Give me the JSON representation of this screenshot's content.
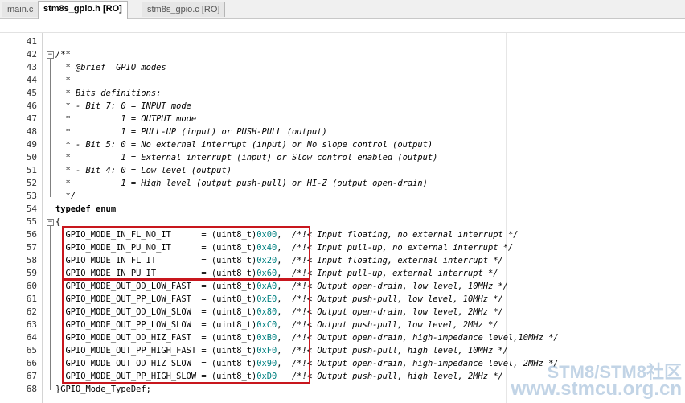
{
  "tabs": [
    {
      "label": "main.c",
      "active": false
    },
    {
      "label": "stm8s_gpio.h [RO]",
      "active": true
    },
    {
      "label": "stm8s_gpio.c [RO]",
      "active": false
    }
  ],
  "lines": [
    {
      "n": "41",
      "parts": []
    },
    {
      "n": "42",
      "parts": [
        {
          "t": "/**",
          "c": "cm"
        }
      ]
    },
    {
      "n": "43",
      "parts": [
        {
          "t": "  * @brief  GPIO modes",
          "c": "cm"
        }
      ]
    },
    {
      "n": "44",
      "parts": [
        {
          "t": "  *",
          "c": "cm"
        }
      ]
    },
    {
      "n": "45",
      "parts": [
        {
          "t": "  * Bits definitions:",
          "c": "cm"
        }
      ]
    },
    {
      "n": "46",
      "parts": [
        {
          "t": "  * - Bit 7: 0 = INPUT mode",
          "c": "cm"
        }
      ]
    },
    {
      "n": "47",
      "parts": [
        {
          "t": "  *          1 = OUTPUT mode",
          "c": "cm"
        }
      ]
    },
    {
      "n": "48",
      "parts": [
        {
          "t": "  *          1 = PULL-UP (input) or PUSH-PULL (output)",
          "c": "cm"
        }
      ]
    },
    {
      "n": "49",
      "parts": [
        {
          "t": "  * - Bit 5: 0 = No external interrupt (input) or No slope control (output)",
          "c": "cm"
        }
      ]
    },
    {
      "n": "50",
      "parts": [
        {
          "t": "  *          1 = External interrupt (input) or Slow control enabled (output)",
          "c": "cm"
        }
      ]
    },
    {
      "n": "51",
      "parts": [
        {
          "t": "  * - Bit 4: 0 = Low level (output)",
          "c": "cm"
        }
      ]
    },
    {
      "n": "52",
      "parts": [
        {
          "t": "  *          1 = High level (output push-pull) or HI-Z (output open-drain)",
          "c": "cm"
        }
      ]
    },
    {
      "n": "53",
      "parts": [
        {
          "t": "  */",
          "c": "cm"
        }
      ]
    },
    {
      "n": "54",
      "parts": [
        {
          "t": "typedef enum",
          "c": "kw"
        }
      ]
    },
    {
      "n": "55",
      "parts": [
        {
          "t": "{",
          "c": ""
        }
      ]
    },
    {
      "n": "56",
      "parts": [
        {
          "t": "  GPIO_MODE_IN_FL_NO_IT      = (uint8_t)",
          "c": ""
        },
        {
          "t": "0x00",
          "c": "hex"
        },
        {
          "t": ",  ",
          "c": ""
        },
        {
          "t": "/*!< Input floating, no external interrupt */",
          "c": "cm"
        }
      ]
    },
    {
      "n": "57",
      "parts": [
        {
          "t": "  GPIO_MODE_IN_PU_NO_IT      = (uint8_t)",
          "c": ""
        },
        {
          "t": "0x40",
          "c": "hex"
        },
        {
          "t": ",  ",
          "c": ""
        },
        {
          "t": "/*!< Input pull-up, no external interrupt */",
          "c": "cm"
        }
      ]
    },
    {
      "n": "58",
      "parts": [
        {
          "t": "  GPIO_MODE_IN_FL_IT         = (uint8_t)",
          "c": ""
        },
        {
          "t": "0x20",
          "c": "hex"
        },
        {
          "t": ",  ",
          "c": ""
        },
        {
          "t": "/*!< Input floating, external interrupt */",
          "c": "cm"
        }
      ]
    },
    {
      "n": "59",
      "parts": [
        {
          "t": "  GPIO_MODE_IN_PU_IT         = (uint8_t)",
          "c": ""
        },
        {
          "t": "0x60",
          "c": "hex"
        },
        {
          "t": ",  ",
          "c": ""
        },
        {
          "t": "/*!< Input pull-up, external interrupt */",
          "c": "cm"
        }
      ]
    },
    {
      "n": "60",
      "parts": [
        {
          "t": "  GPIO_MODE_OUT_OD_LOW_FAST  = (uint8_t)",
          "c": ""
        },
        {
          "t": "0xA0",
          "c": "hex"
        },
        {
          "t": ",  ",
          "c": ""
        },
        {
          "t": "/*!< Output open-drain, low level, 10MHz */",
          "c": "cm"
        }
      ]
    },
    {
      "n": "61",
      "parts": [
        {
          "t": "  GPIO_MODE_OUT_PP_LOW_FAST  = (uint8_t)",
          "c": ""
        },
        {
          "t": "0xE0",
          "c": "hex"
        },
        {
          "t": ",  ",
          "c": ""
        },
        {
          "t": "/*!< Output push-pull, low level, 10MHz */",
          "c": "cm"
        }
      ]
    },
    {
      "n": "62",
      "parts": [
        {
          "t": "  GPIO_MODE_OUT_OD_LOW_SLOW  = (uint8_t)",
          "c": ""
        },
        {
          "t": "0x80",
          "c": "hex"
        },
        {
          "t": ",  ",
          "c": ""
        },
        {
          "t": "/*!< Output open-drain, low level, 2MHz */",
          "c": "cm"
        }
      ]
    },
    {
      "n": "63",
      "parts": [
        {
          "t": "  GPIO_MODE_OUT_PP_LOW_SLOW  = (uint8_t)",
          "c": ""
        },
        {
          "t": "0xC0",
          "c": "hex"
        },
        {
          "t": ",  ",
          "c": ""
        },
        {
          "t": "/*!< Output push-pull, low level, 2MHz */",
          "c": "cm"
        }
      ]
    },
    {
      "n": "64",
      "parts": [
        {
          "t": "  GPIO_MODE_OUT_OD_HIZ_FAST  = (uint8_t)",
          "c": ""
        },
        {
          "t": "0xB0",
          "c": "hex"
        },
        {
          "t": ",  ",
          "c": ""
        },
        {
          "t": "/*!< Output open-drain, high-impedance level,10MHz */",
          "c": "cm"
        }
      ]
    },
    {
      "n": "65",
      "parts": [
        {
          "t": "  GPIO_MODE_OUT_PP_HIGH_FAST = (uint8_t)",
          "c": ""
        },
        {
          "t": "0xF0",
          "c": "hex"
        },
        {
          "t": ",  ",
          "c": ""
        },
        {
          "t": "/*!< Output push-pull, high level, 10MHz */",
          "c": "cm"
        }
      ]
    },
    {
      "n": "66",
      "parts": [
        {
          "t": "  GPIO_MODE_OUT_OD_HIZ_SLOW  = (uint8_t)",
          "c": ""
        },
        {
          "t": "0x90",
          "c": "hex"
        },
        {
          "t": ",  ",
          "c": ""
        },
        {
          "t": "/*!< Output open-drain, high-impedance level, 2MHz */",
          "c": "cm"
        }
      ]
    },
    {
      "n": "67",
      "parts": [
        {
          "t": "  GPIO_MODE_OUT_PP_HIGH_SLOW = (uint8_t)",
          "c": ""
        },
        {
          "t": "0xD0",
          "c": "hex"
        },
        {
          "t": "   ",
          "c": ""
        },
        {
          "t": "/*!< Output push-pull, high level, 2MHz */",
          "c": "cm"
        }
      ]
    },
    {
      "n": "68",
      "parts": [
        {
          "t": "}GPIO_Mode_TypeDef;",
          "c": ""
        }
      ]
    }
  ],
  "watermark": {
    "line1": "STM8/STM8社区",
    "line2": "www.stmcu.org.cn"
  },
  "colors": {
    "highlight_box": "#c8161d",
    "hex_literal": "#008080"
  }
}
